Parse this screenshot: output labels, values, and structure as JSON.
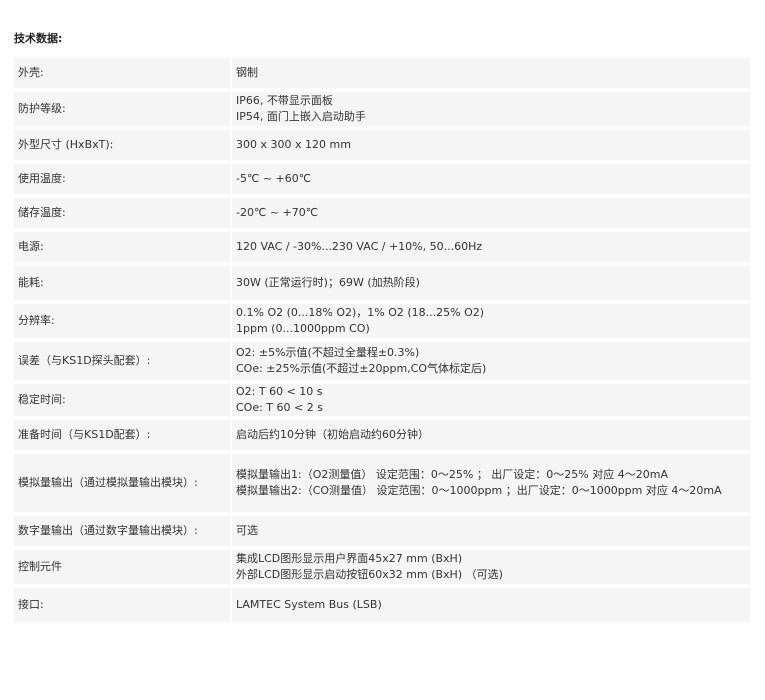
{
  "heading": "技术数据:",
  "rows": [
    {
      "label": "外壳:",
      "lines": [
        "钢制"
      ]
    },
    {
      "label": "防护等级:",
      "lines": [
        "IP66, 不带显示面板",
        "IP54, 面门上嵌入启动助手"
      ]
    },
    {
      "label": "外型尺寸 (HxBxT):",
      "lines": [
        "300 x 300 x 120 mm"
      ]
    },
    {
      "label": "使用温度:",
      "lines": [
        "-5℃ ~ +60℃"
      ]
    },
    {
      "label": "储存温度:",
      "lines": [
        "-20℃ ~ +70℃"
      ]
    },
    {
      "label": "电源:",
      "lines": [
        "120 VAC / -30%...230 VAC / +10%, 50...60Hz"
      ]
    },
    {
      "label": "能耗:",
      "lines": [
        "30W (正常运行时)；69W (加热阶段)"
      ]
    },
    {
      "label": "分辨率:",
      "lines": [
        "0.1% O2 (0...18% O2)，1% O2 (18...25% O2)",
        "1ppm (0...1000ppm CO)"
      ]
    },
    {
      "label": "误差（与KS1D探头配套）:",
      "lines": [
        "O2: ±5%示值(不超过全量程±0.3%)",
        "COe: ±25%示值(不超过±20ppm,CO气体标定后)"
      ]
    },
    {
      "label": "稳定时间:",
      "lines": [
        "O2: T 60 < 10 s",
        "COe: T 60 < 2 s"
      ]
    },
    {
      "label": "准备时间（与KS1D配套）:",
      "lines": [
        "启动后约10分钟（初始启动约60分钟）"
      ]
    },
    {
      "label": "模拟量输出（通过模拟量输出模块）:",
      "lines": [
        "模拟量输出1:（O2测量值） 设定范围：0～25% ； 出厂设定：0～25% 对应 4～20mA",
        "模拟量输出2:（CO测量值） 设定范围：0～1000ppm ；出厂设定：0～1000ppm 对应 4～20mA"
      ]
    },
    {
      "label": "数字量输出（通过数字量输出模块）:",
      "lines": [
        "可选"
      ]
    },
    {
      "label": "控制元件",
      "lines": [
        "集成LCD图形显示用户界面45x27 mm (BxH)",
        "外部LCD图形显示启动按钮60x32 mm (BxH) （可选)"
      ]
    },
    {
      "label": "接口:",
      "lines": [
        "LAMTEC System Bus (LSB)"
      ]
    }
  ]
}
